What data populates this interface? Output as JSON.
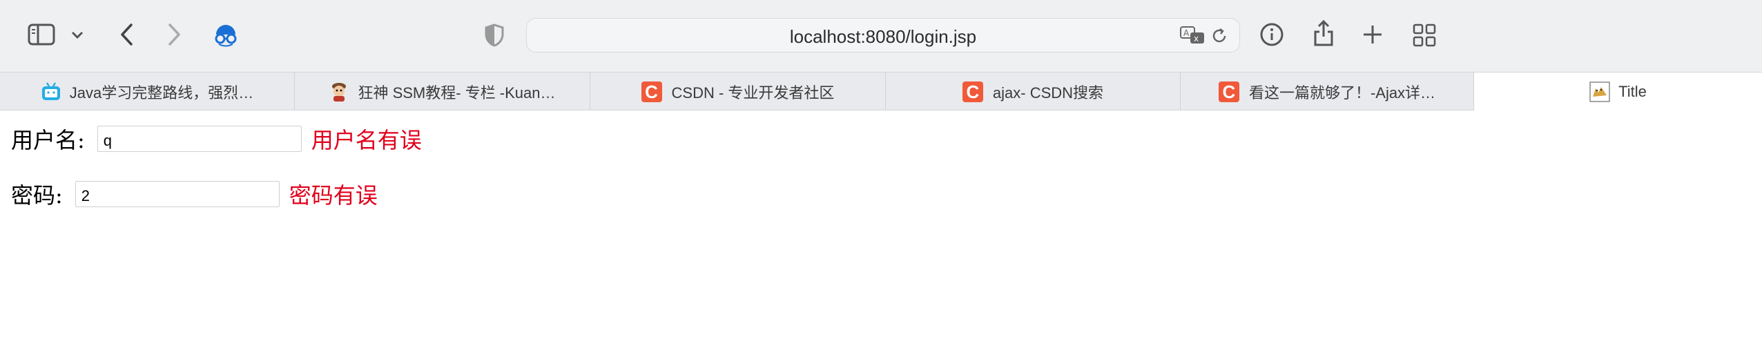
{
  "toolbar": {
    "url": "localhost:8080/login.jsp",
    "icons": [
      "sidebar-icon",
      "chevron-down-icon",
      "back-icon",
      "forward-icon",
      "profile-icon",
      "shield-icon",
      "translate-icon",
      "reload-icon",
      "info-icon",
      "share-icon",
      "plus-icon",
      "tab-overview-icon"
    ]
  },
  "tabs": [
    {
      "title": "Java学习完整路线，强烈…",
      "favicon": "bilibili-icon"
    },
    {
      "title": "狂神 SSM教程- 专栏 -Kuan…",
      "favicon": "avatar-icon"
    },
    {
      "title": "CSDN - 专业开发者社区",
      "favicon": "csdn-icon"
    },
    {
      "title": "ajax- CSDN搜索",
      "favicon": "csdn-icon"
    },
    {
      "title": "看这一篇就够了！-Ajax详…",
      "favicon": "csdn-icon"
    },
    {
      "title": "Title",
      "favicon": "tomcat-icon",
      "active": true
    }
  ],
  "form": {
    "username_label": "用户名:",
    "username_value": "q",
    "username_error": "用户名有误",
    "password_label": "密码:",
    "password_value": "2",
    "password_error": "密码有误"
  },
  "colors": {
    "error": "#e0001b",
    "csdn": "#f05a3a",
    "profile": "#1a73e8"
  }
}
